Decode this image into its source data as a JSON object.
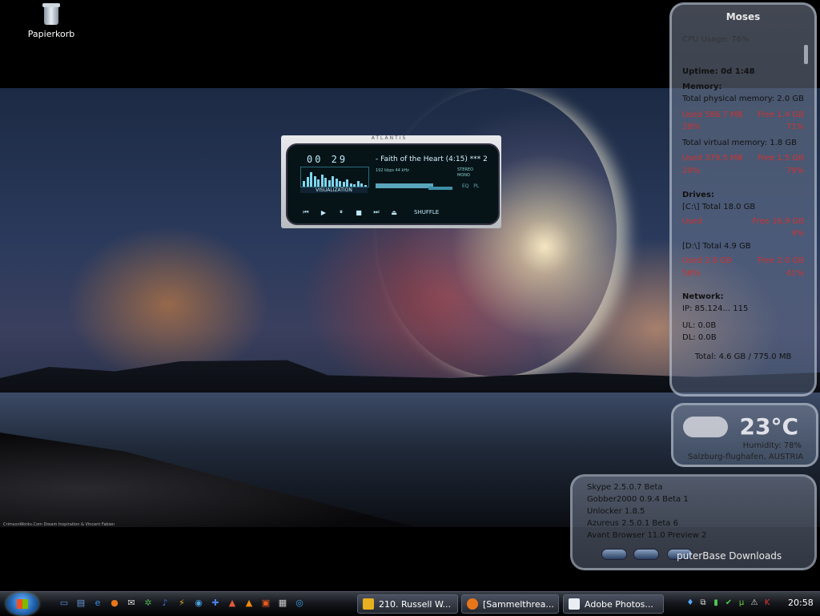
{
  "desktop": {
    "icons": [
      {
        "label": "Papierkorb",
        "icon": "recycle-bin-icon"
      }
    ],
    "wallpaper_credit": "CrimsonWorks.Com Dream Inspiration & Vincent Fabien"
  },
  "player": {
    "brand": "ATLANTIS",
    "time": "00 29",
    "track": "- Faith of the Heart (4:15) *** 2",
    "bitrate": "192 kbps 44 kHz",
    "stereo": "STEREO",
    "mono": "MONO",
    "visualization_label": "VISUALIZATION",
    "eq_label": "EQ",
    "pl_label": "PL",
    "controls": [
      "prev",
      "play",
      "pause",
      "stop",
      "next",
      "eject"
    ],
    "shuffle_label": "SHUFFLE",
    "visualizer_levels": [
      0.3,
      0.55,
      0.8,
      0.6,
      0.4,
      0.7,
      0.5,
      0.35,
      0.6,
      0.45,
      0.3,
      0.25,
      0.4,
      0.2,
      0.15,
      0.3,
      0.2,
      0.1
    ]
  },
  "sysinfo": {
    "title": "Moses",
    "cpu": "CPU Usage: 76%",
    "uptime": "Uptime: 0d 1:48",
    "memory_heading": "Memory:",
    "physical_total": "Total physical memory: 2.0 GB",
    "physical_used": "Used 586.7 MB",
    "physical_free": "Free 1.4 GB",
    "physical_used_pct": "28%",
    "physical_free_pct": "71%",
    "virtual_total": "Total virtual memory: 1.8 GB",
    "virtual_used": "Used 379.5 MB",
    "virtual_free": "Free 1.5 GB",
    "virtual_used_pct": "20%",
    "virtual_free_pct": "79%",
    "drives_heading": "Drives:",
    "drive_c": "[C:\\] Total 18.0 GB",
    "drive_c_used": "Used",
    "drive_c_free": "Free 16.9 GB",
    "drive_c_free_pct": "4%",
    "drive_d": "[D:\\] Total 4.9 GB",
    "drive_d_used": "Used 2.8 GB",
    "drive_d_free": "Free 2.0 GB",
    "drive_d_used_pct": "58%",
    "drive_d_free_pct": "41%",
    "network_heading": "Network:",
    "ip": "IP:    85.124... 115",
    "ul": "UL: 0.0B",
    "dl": "DL: 0.0B",
    "total": "Total: 4.6 GB / 775.0 MB"
  },
  "weather": {
    "temp": "23°C",
    "humidity": "Humidity: 78%",
    "location": "Salzburg-flughafen, AUSTRIA"
  },
  "downloads": {
    "items": [
      "Skype 2.5.0.7 Beta",
      "Gobber2000 0.9.4 Beta 1",
      "Unlocker 1.8.5",
      "Azureus 2.5.0.1 Beta 6",
      "Avant Browser 11.0 Preview 2"
    ],
    "title": "puterBase Downloads"
  },
  "taskbar": {
    "quicklaunch": [
      {
        "name": "show-desktop-icon",
        "glyph": "▭",
        "color": "#5b8ed6"
      },
      {
        "name": "switch-windows-icon",
        "glyph": "▤",
        "color": "#6b9ad6"
      },
      {
        "name": "internet-explorer-icon",
        "glyph": "e",
        "color": "#3a8ee6"
      },
      {
        "name": "firefox-icon",
        "glyph": "●",
        "color": "#e8751a"
      },
      {
        "name": "mail-icon",
        "glyph": "✉",
        "color": "#ddd"
      },
      {
        "name": "green-app-icon",
        "glyph": "✲",
        "color": "#4caf50"
      },
      {
        "name": "media-icon",
        "glyph": "♪",
        "color": "#3b6fd6"
      },
      {
        "name": "winamp-icon",
        "glyph": "⚡",
        "color": "#e8b020"
      },
      {
        "name": "app-icon",
        "glyph": "◉",
        "color": "#4aa0e0"
      },
      {
        "name": "messenger-icon",
        "glyph": "✚",
        "color": "#4a7fe0"
      },
      {
        "name": "paint-icon",
        "glyph": "▲",
        "color": "#e05a3a"
      },
      {
        "name": "vlc-icon",
        "glyph": "▲",
        "color": "#f08a10"
      },
      {
        "name": "orange-app-icon",
        "glyph": "▣",
        "color": "#e85a20"
      },
      {
        "name": "checker-icon",
        "glyph": "▦",
        "color": "#ccc"
      },
      {
        "name": "search-icon",
        "glyph": "◎",
        "color": "#3aa0e6"
      }
    ],
    "tasks": [
      {
        "label": "210. Russell W...",
        "icon_color": "#e8b020",
        "name": "task-winamp"
      },
      {
        "label": "[Sammelthrea...",
        "icon_color": "#e8751a",
        "name": "task-firefox"
      },
      {
        "label": "Adobe Photos...",
        "icon_color": "#eaeef4",
        "name": "task-photoshop"
      }
    ],
    "tray": [
      {
        "name": "speaker-icon",
        "glyph": "♦",
        "color": "#5af"
      },
      {
        "name": "network-icon",
        "glyph": "⧉",
        "color": "#ddd"
      },
      {
        "name": "signal-icon",
        "glyph": "▮",
        "color": "#5c5"
      },
      {
        "name": "update-icon",
        "glyph": "✔",
        "color": "#4c4"
      },
      {
        "name": "utorrent-icon",
        "glyph": "µ",
        "color": "#6c3"
      },
      {
        "name": "security-icon",
        "glyph": "⚠",
        "color": "#ddd"
      },
      {
        "name": "antivirus-icon",
        "glyph": "K",
        "color": "#e33"
      }
    ],
    "clock": "20:58"
  }
}
